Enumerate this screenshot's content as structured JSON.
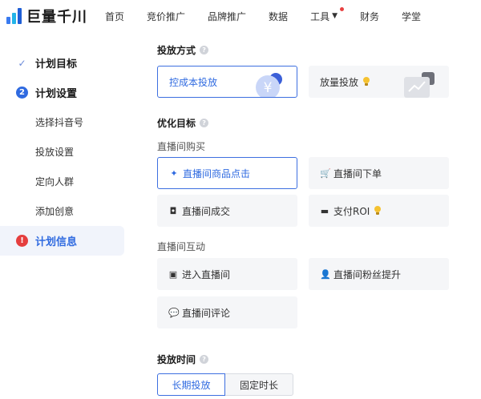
{
  "logo": {
    "text": "巨量千川"
  },
  "nav": [
    {
      "label": "首页"
    },
    {
      "label": "竞价推广"
    },
    {
      "label": "品牌推广"
    },
    {
      "label": "数据"
    },
    {
      "label": "工具"
    },
    {
      "label": "财务"
    },
    {
      "label": "学堂"
    }
  ],
  "sidebar": {
    "step1": {
      "label": "计划目标"
    },
    "step2": {
      "label": "计划设置",
      "num": "2"
    },
    "sub": [
      {
        "label": "选择抖音号"
      },
      {
        "label": "投放设置"
      },
      {
        "label": "定向人群"
      },
      {
        "label": "添加创意"
      }
    ],
    "step3": {
      "label": "计划信息",
      "num": "!"
    }
  },
  "delivery_method": {
    "title": "投放方式",
    "options": [
      {
        "label": "控成本投放",
        "selected": true
      },
      {
        "label": "放量投放",
        "selected": false
      }
    ]
  },
  "optimization": {
    "title": "优化目标",
    "purchase_group": {
      "label": "直播间购买",
      "options": [
        {
          "label": "直播间商品点击",
          "selected": true
        },
        {
          "label": "直播间下单"
        },
        {
          "label": "直播间成交"
        },
        {
          "label": "支付ROI"
        }
      ]
    },
    "interaction_group": {
      "label": "直播间互动",
      "options": [
        {
          "label": "进入直播间"
        },
        {
          "label": "直播间粉丝提升"
        },
        {
          "label": "直播间评论"
        }
      ]
    }
  },
  "delivery_time": {
    "title": "投放时间",
    "tabs": [
      {
        "label": "长期投放",
        "active": true
      },
      {
        "label": "固定时长",
        "active": false
      }
    ]
  },
  "icons": {
    "yen_symbol": "¥",
    "help_symbol": "?"
  },
  "colors": {
    "accent": "#2f6ae0",
    "error": "#e53e3e"
  }
}
